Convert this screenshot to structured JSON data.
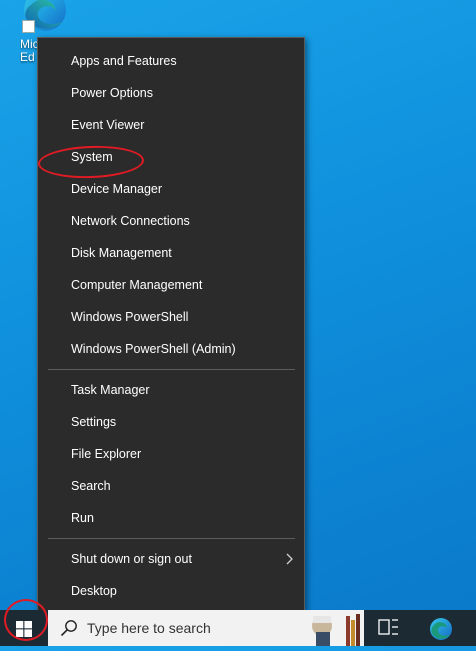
{
  "desktop": {
    "icons": [
      {
        "label": "Micro\nEd",
        "icon": "edge-icon"
      }
    ]
  },
  "context_menu": {
    "groups": [
      [
        "Apps and Features",
        "Power Options",
        "Event Viewer",
        "System",
        "Device Manager",
        "Network Connections",
        "Disk Management",
        "Computer Management",
        "Windows PowerShell",
        "Windows PowerShell (Admin)"
      ],
      [
        "Task Manager",
        "Settings",
        "File Explorer",
        "Search",
        "Run"
      ],
      [
        "Shut down or sign out",
        "Desktop"
      ]
    ],
    "submenu_items": [
      "Shut down or sign out"
    ],
    "highlighted_item": "System"
  },
  "taskbar": {
    "search_placeholder": "Type here to search",
    "icons": [
      "windows-logo-icon",
      "search-icon",
      "task-view-icon",
      "edge-icon"
    ]
  },
  "annotations": {
    "color": "#e01b24",
    "circled": [
      "System",
      "start-button"
    ]
  },
  "colors": {
    "desktop": "#0f8fdc",
    "menu_bg": "#2b2b2b",
    "taskbar": "#1c2a34",
    "search_bg": "#f2f2f2"
  }
}
